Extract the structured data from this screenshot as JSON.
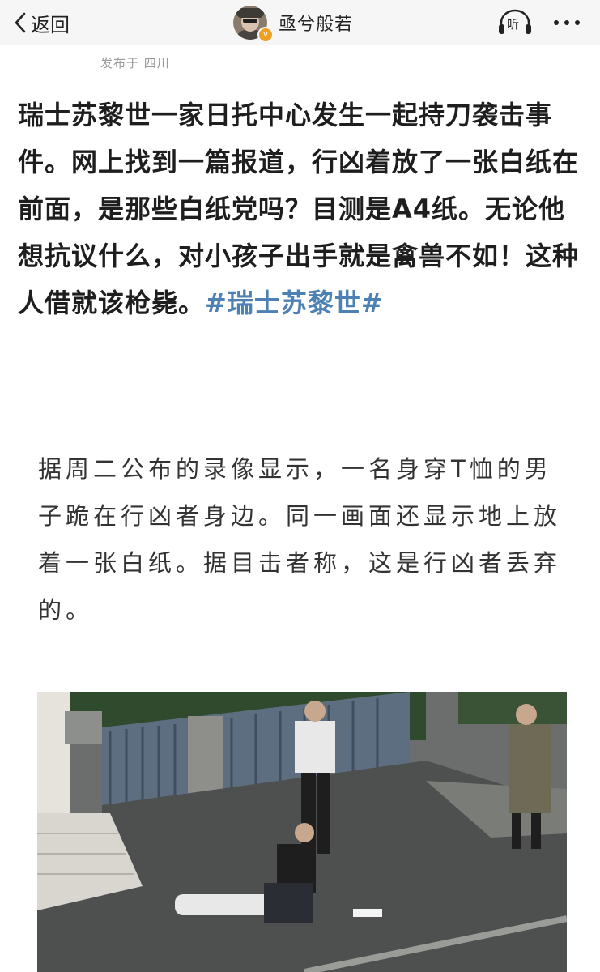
{
  "nav": {
    "back_label": "返回",
    "author_name": "亟兮般若",
    "listen_label": "听"
  },
  "post": {
    "location": "发布于 四川",
    "text": "瑞士苏黎世一家日托中心发生一起持刀袭击事件。网上找到一篇报道，行凶着放了一张白纸在前面，是那些白纸党吗？目测是A4纸。无论他想抗议什么，对小孩子出手就是禽兽不如！这种人借就该枪毙。",
    "hashtag": "#瑞士苏黎世#",
    "quote": "据周二公布的录像显示，一名身穿T恤的男子跪在行凶者身边。同一画面还显示地上放着一张白纸。据目击者称，这是行凶者丢弃的。"
  },
  "colors": {
    "hashtag": "#4d80b3",
    "nav_background": "#f6f6f6",
    "verified_badge": "#f0a020"
  },
  "icons": {
    "back": "chevron-left-icon",
    "listen": "headphones-icon",
    "more": "more-dots-icon",
    "verified": "verified-badge-icon"
  }
}
